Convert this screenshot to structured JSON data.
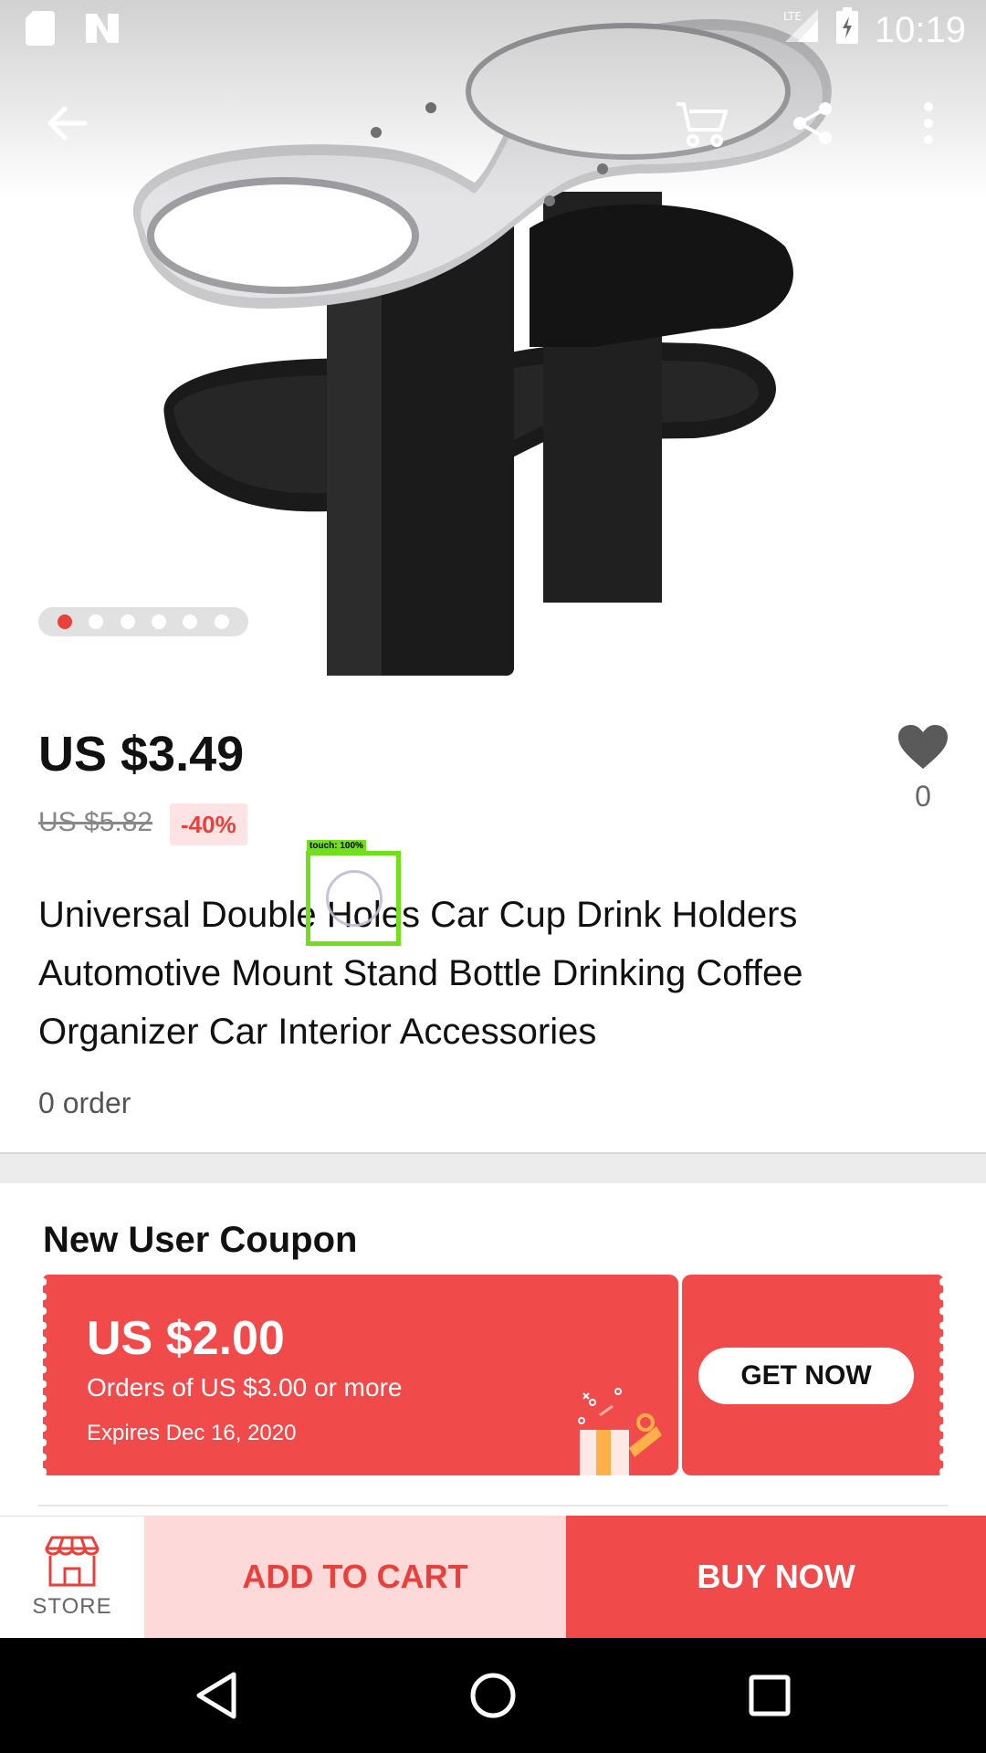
{
  "status_bar": {
    "network": "LTE",
    "time": "10:19"
  },
  "gallery": {
    "page_count": 6,
    "current_page": 1
  },
  "product": {
    "price": "US $3.49",
    "original_price": "US $5.82",
    "discount": "-40%",
    "wishlist_count": "0",
    "title": "Universal Double Holes Car Cup Drink Holders Automotive Mount Stand Bottle Drinking Coffee Organizer Car Interior Accessories",
    "orders": "0 order"
  },
  "coupon": {
    "heading": "New User Coupon",
    "amount": "US $2.00",
    "condition": "Orders of US $3.00 or more",
    "expires": "Expires Dec 16, 2020",
    "button_label": "GET NOW"
  },
  "action_bar": {
    "store_label": "STORE",
    "add_to_cart_label": "ADD TO CART",
    "buy_now_label": "BUY NOW"
  },
  "touch_indicator": {
    "label": "touch: 100%"
  },
  "colors": {
    "accent": "#e8413c",
    "coupon_bg": "#f04a4a",
    "add_cart_bg": "#fdd9d9"
  }
}
